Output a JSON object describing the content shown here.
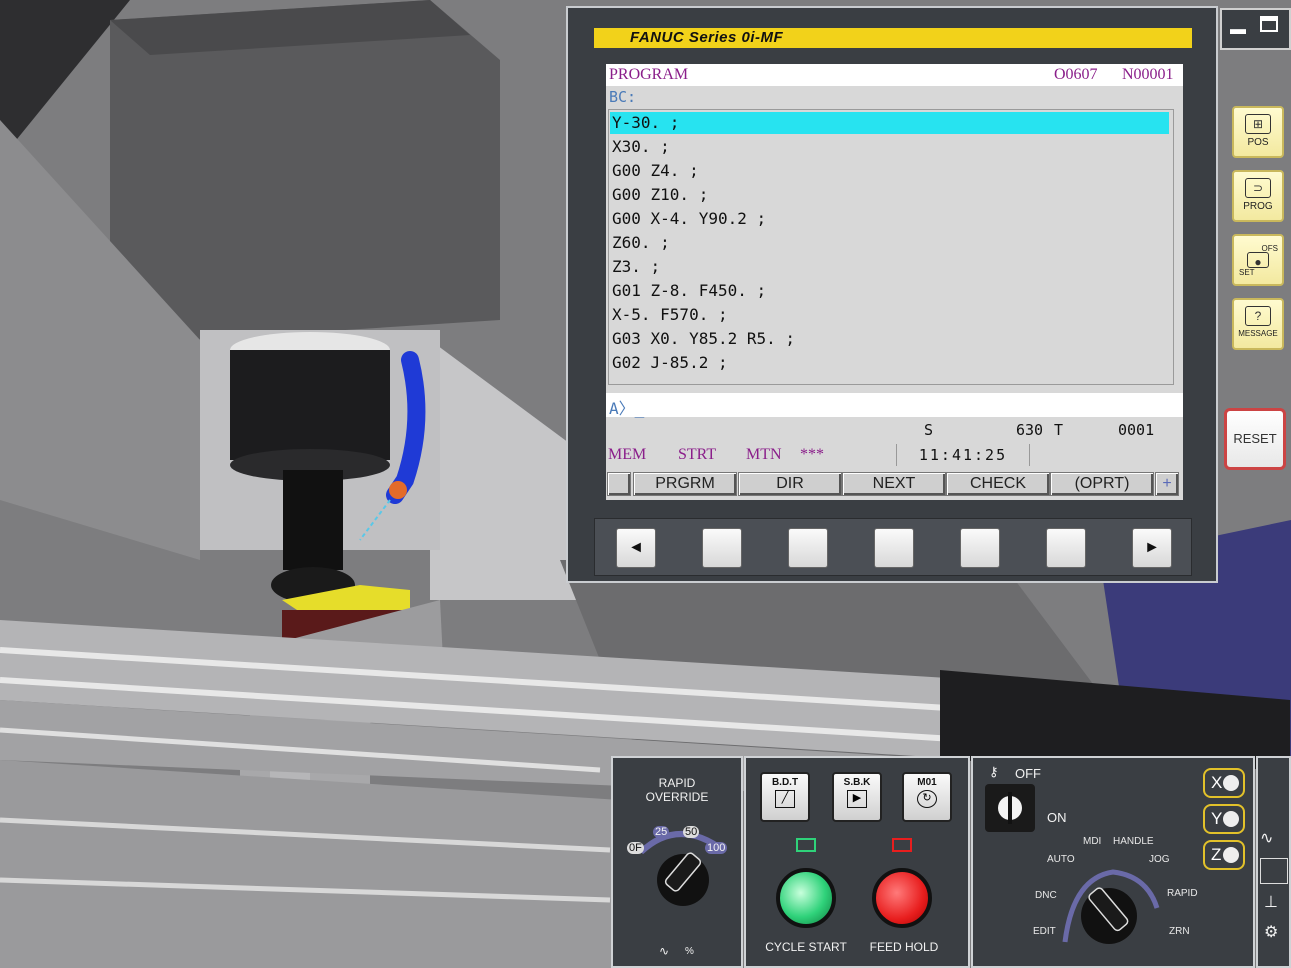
{
  "control": {
    "title": "FANUC Series 0i-MF",
    "screen_header": {
      "mode": "PROGRAM",
      "program_no": "O0607",
      "sequence_no": "N00001"
    },
    "bc_label": "BC:",
    "program_lines": [
      "Y-30. ;",
      "X30. ;",
      "G00 Z4. ;",
      "G00 Z10. ;",
      "G00 X-4. Y90.2 ;",
      "Z60. ;",
      "Z3. ;",
      "G01 Z-8. F450. ;",
      "X-5. F570. ;",
      "G03 X0. Y85.2 R5. ;",
      "G02 J-85.2 ;"
    ],
    "input_prompt": "A〉_",
    "spindle_label": "S",
    "spindle_value": "630",
    "tool_label": "T",
    "tool_value": "0001",
    "status_mode": "MEM",
    "status_run": "STRT",
    "status_motion": "MTN",
    "status_alarm": "***",
    "clock": "11:41:25",
    "softkeys": [
      "PRGRM",
      "DIR",
      "NEXT",
      "CHECK",
      "(OPRT)",
      "+"
    ],
    "nav_left": "◄",
    "nav_right": "►"
  },
  "side_keys": {
    "pos": "POS",
    "prog": "PROG",
    "ofs": "OFS",
    "set": "SET",
    "message": "MESSAGE",
    "reset": "RESET"
  },
  "operator_panel": {
    "rapid_override_label": "RAPID\nOVERRIDE",
    "rapid_settings": [
      "0F",
      "25",
      "50",
      "100"
    ],
    "feed_unit_label": "%",
    "bdt": "B.D.T",
    "sbk": "S.B.K",
    "m01": "M01",
    "cycle_start": "CYCLE START",
    "feed_hold": "FEED HOLD",
    "key_off": "OFF",
    "key_on": "ON",
    "modes": {
      "mdi": "MDI",
      "handle": "HANDLE",
      "auto": "AUTO",
      "jog": "JOG",
      "dnc": "DNC",
      "rapid": "RAPID",
      "edit": "EDIT",
      "zrn": "ZRN"
    },
    "axes": [
      "X",
      "Y",
      "Z"
    ]
  },
  "colors": {
    "title_bar": "#f2d21a",
    "screen_bg": "#d8d8d8",
    "highlight": "#27e3f0",
    "status_text": "#8a1e8a",
    "cycle_start": "#2fd27a",
    "feed_hold": "#e81e1e",
    "panel_bg": "#3a3e43"
  }
}
